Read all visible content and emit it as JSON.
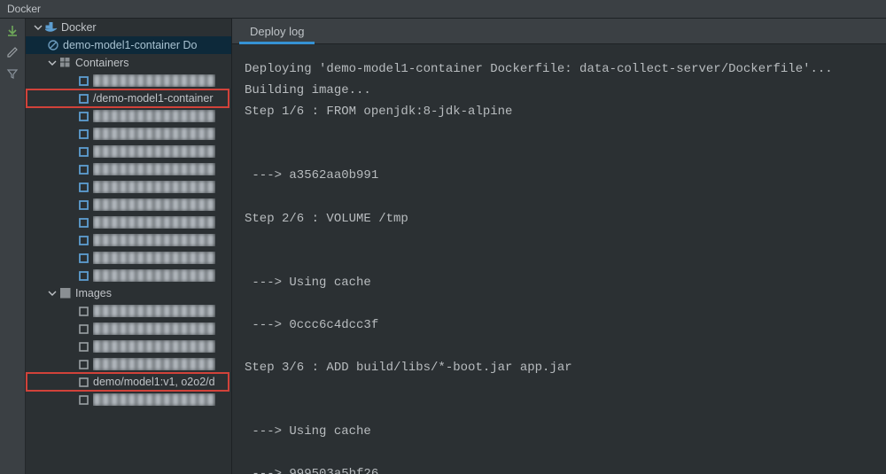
{
  "window": {
    "title": "Docker"
  },
  "tree": {
    "root": {
      "label": "Docker"
    },
    "selected": {
      "label": "demo-model1-container Do"
    },
    "containers": {
      "label": "Containers",
      "items": [
        {
          "label": "██████████████"
        },
        {
          "label": "/demo-model1-container",
          "highlight": true
        },
        {
          "label": "██████████████"
        },
        {
          "label": "██████████████"
        },
        {
          "label": "██████████████"
        },
        {
          "label": "██████████████"
        },
        {
          "label": "██████████████"
        },
        {
          "label": "██████████████"
        },
        {
          "label": "██████████████"
        },
        {
          "label": "██████████████"
        },
        {
          "label": "██████████████"
        },
        {
          "label": "██████████████"
        }
      ]
    },
    "images": {
      "label": "Images",
      "items": [
        {
          "label": "██████████████"
        },
        {
          "label": "██████████████"
        },
        {
          "label": "██████████████"
        },
        {
          "label": "██████████████"
        },
        {
          "label": "demo/model1:v1, o2o2/d",
          "highlight": true
        },
        {
          "label": "██████████████"
        }
      ]
    }
  },
  "tabs": {
    "deploy_log": "Deploy log"
  },
  "log_lines": [
    "Deploying 'demo-model1-container Dockerfile: data-collect-server/Dockerfile'...",
    "Building image...",
    "Step 1/6 : FROM openjdk:8-jdk-alpine",
    "",
    "",
    " ---> a3562aa0b991",
    "",
    "Step 2/6 : VOLUME /tmp",
    "",
    "",
    " ---> Using cache",
    "",
    " ---> 0ccc6c4dcc3f",
    "",
    "Step 3/6 : ADD build/libs/*-boot.jar app.jar",
    "",
    "",
    " ---> Using cache",
    "",
    " ---> 999503a5bf26"
  ]
}
